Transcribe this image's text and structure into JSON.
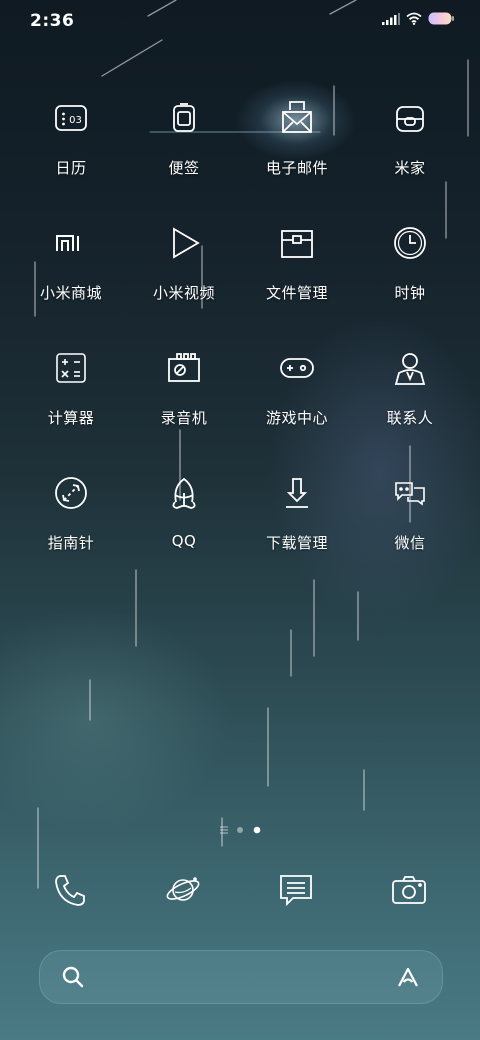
{
  "status_bar": {
    "time": "2:36",
    "icons": [
      "signal-icon",
      "wifi-icon",
      "battery-icon"
    ]
  },
  "apps": [
    {
      "label": "日历",
      "icon": "calendar-icon",
      "icon_text": "03"
    },
    {
      "label": "便签",
      "icon": "notes-icon"
    },
    {
      "label": "电子邮件",
      "icon": "email-icon"
    },
    {
      "label": "米家",
      "icon": "mijia-icon"
    },
    {
      "label": "小米商城",
      "icon": "mi-store-icon",
      "icon_text": "mi"
    },
    {
      "label": "小米视频",
      "icon": "video-play-icon"
    },
    {
      "label": "文件管理",
      "icon": "file-manager-icon"
    },
    {
      "label": "时钟",
      "icon": "clock-icon"
    },
    {
      "label": "计算器",
      "icon": "calculator-icon"
    },
    {
      "label": "录音机",
      "icon": "recorder-icon"
    },
    {
      "label": "游戏中心",
      "icon": "gamepad-icon"
    },
    {
      "label": "联系人",
      "icon": "contacts-icon"
    },
    {
      "label": "指南针",
      "icon": "compass-icon"
    },
    {
      "label": "QQ",
      "icon": "qq-penguin-icon"
    },
    {
      "label": "下载管理",
      "icon": "download-icon"
    },
    {
      "label": "微信",
      "icon": "wechat-icon"
    }
  ],
  "page_indicator": {
    "pages": 3,
    "current_page": 3
  },
  "dock": [
    "phone-icon",
    "browser-planet-icon",
    "messages-icon",
    "camera-icon"
  ],
  "search_bar": {
    "left_icon": "search-icon",
    "right_icon": "xiao-ai-icon"
  }
}
